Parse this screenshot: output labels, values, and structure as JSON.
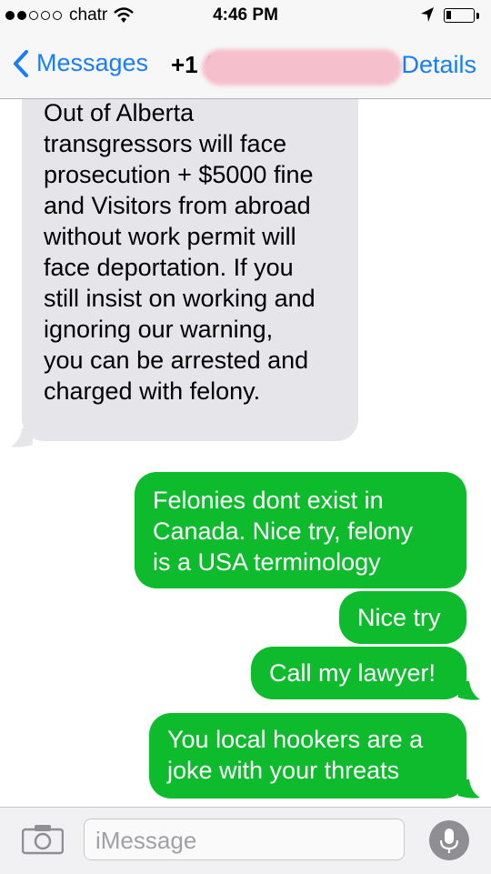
{
  "status_bar": {
    "carrier": "chatr",
    "time": "4:46 PM"
  },
  "nav": {
    "back_label": "Messages",
    "contact": "+1 (",
    "details_label": "Details"
  },
  "messages": [
    {
      "sender": "them",
      "text": "...the Government's laws.\nOut of Alberta\ntransgressors will face\nprosecution + $5000 fine\nand Visitors from abroad\nwithout work permit will\nface deportation. If you\nstill insist on working and\nignoring our warning,\nyou can be arrested and\ncharged with felony."
    },
    {
      "sender": "me",
      "text": "Felonies dont exist in\nCanada.  Nice try, felony\nis a USA terminology"
    },
    {
      "sender": "me",
      "text": "Nice try"
    },
    {
      "sender": "me",
      "text": "Call my lawyer!"
    },
    {
      "sender": "me",
      "text": "You local hookers are a\njoke with your threats"
    }
  ],
  "input": {
    "placeholder": "iMessage"
  },
  "colors": {
    "accent": "#1a7cf6",
    "sent_bubble": "#0dbb2c",
    "received_bubble": "#e5e5ea"
  },
  "icons": [
    "signal-dots-icon",
    "wifi-icon",
    "location-arrow-icon",
    "battery-icon",
    "chevron-left-icon",
    "camera-icon",
    "microphone-icon"
  ]
}
